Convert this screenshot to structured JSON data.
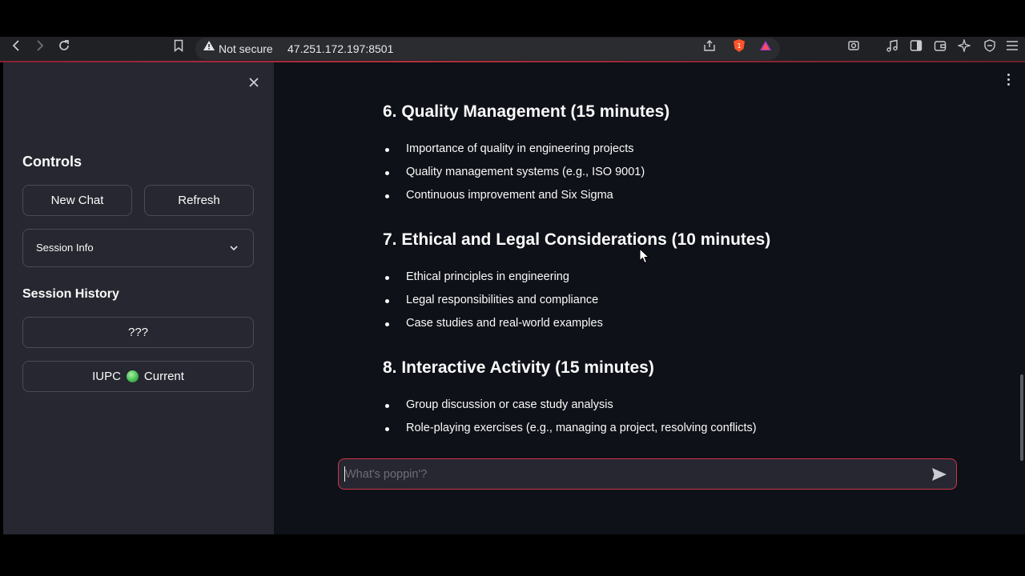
{
  "browser": {
    "security_label": "Not secure",
    "url": "47.251.172.197:8501",
    "brave_badge": "1"
  },
  "sidebar": {
    "controls_title": "Controls",
    "new_chat_label": "New Chat",
    "refresh_label": "Refresh",
    "session_info_label": "Session Info",
    "history_title": "Session History",
    "history_items": [
      {
        "label": "???"
      },
      {
        "label": "IUPC",
        "status": "Current"
      }
    ]
  },
  "content": {
    "sections": [
      {
        "heading": "6. Quality Management (15 minutes)",
        "bullets": [
          "Importance of quality in engineering projects",
          "Quality management systems (e.g., ISO 9001)",
          "Continuous improvement and Six Sigma"
        ]
      },
      {
        "heading": "7. Ethical and Legal Considerations (10 minutes)",
        "bullets": [
          "Ethical principles in engineering",
          "Legal responsibilities and compliance",
          "Case studies and real-world examples"
        ]
      },
      {
        "heading": "8. Interactive Activity (15 minutes)",
        "bullets": [
          "Group discussion or case study analysis",
          "Role-playing exercises (e.g., managing a project, resolving conflicts)"
        ]
      }
    ]
  },
  "chat": {
    "placeholder": "What's poppin'?"
  },
  "colors": {
    "accent": "#d1344a",
    "sidebar_bg": "#262730",
    "main_bg": "#0e1117",
    "status_dot": "#3fb950"
  }
}
